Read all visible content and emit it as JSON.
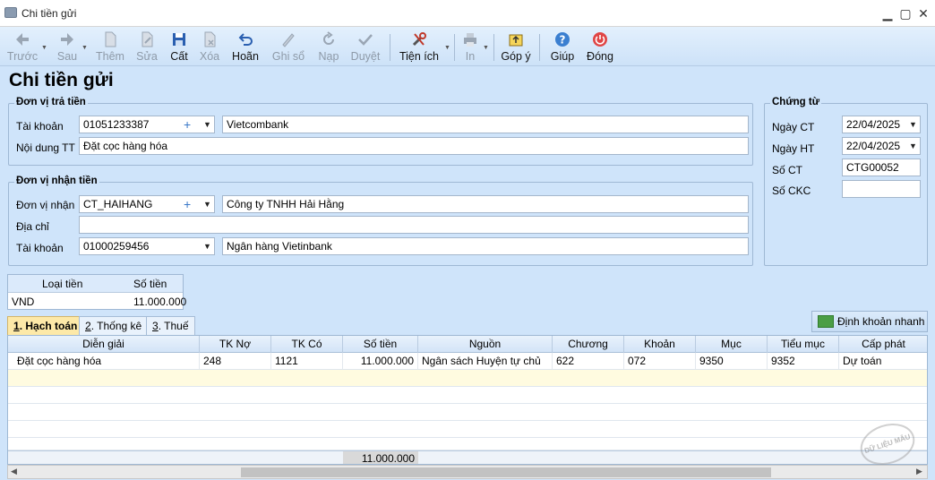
{
  "window": {
    "title": "Chi tiền gửi",
    "minimize": "▁",
    "maximize": "▢",
    "close": "✕"
  },
  "toolbar": {
    "back": "Trước",
    "next": "Sau",
    "add": "Thêm",
    "edit": "Sửa",
    "save": "Cất",
    "delete": "Xóa",
    "undo": "Hoãn",
    "post": "Ghi sổ",
    "reload": "Nạp",
    "approve": "Duyệt",
    "utilities": "Tiện ích",
    "print": "In",
    "feedback": "Góp ý",
    "help": "Giúp",
    "close": "Đóng"
  },
  "page_title": "Chi tiền gửi",
  "payer": {
    "legend": "Đơn vị trả tiền",
    "account_label": "Tài khoản",
    "account_value": "01051233387",
    "bank_name": "Vietcombank",
    "content_label": "Nội dung TT",
    "content_value": "Đặt cọc hàng hóa"
  },
  "payee": {
    "legend": "Đơn vị nhận tiền",
    "unit_label": "Đơn vị nhận",
    "unit_code": "CT_HAIHANG",
    "unit_name": "Công ty TNHH Hải Hằng",
    "address_label": "Địa chỉ",
    "address_value": "",
    "account_label": "Tài khoản",
    "account_value": "01000259456",
    "bank_name": "Ngân hàng Vietinbank"
  },
  "voucher": {
    "legend": "Chứng từ",
    "date_label": "Ngày CT",
    "date_value": "22/04/2025",
    "post_date_label": "Ngày HT",
    "post_date_value": "22/04/2025",
    "number_label": "Số CT",
    "number_value": "CTG00052",
    "ckc_label": "Số CKC",
    "ckc_value": ""
  },
  "currency": {
    "col_type": "Loại tiền",
    "col_amount": "Số tiền",
    "type": "VND",
    "amount": "11.000.000"
  },
  "tabs": [
    {
      "key": "1",
      "label": ". Hạch toán"
    },
    {
      "key": "2",
      "label": ". Thống kê"
    },
    {
      "key": "3",
      "label": ". Thuế"
    }
  ],
  "quick_entry": "Định khoản nhanh",
  "grid": {
    "columns": [
      "Diễn giải",
      "TK Nợ",
      "TK Có",
      "Số tiền",
      "Nguồn",
      "Chương",
      "Khoản",
      "Mục",
      "Tiểu mục",
      "Cấp phát"
    ],
    "rows": [
      [
        "Đặt cọc hàng hóa",
        "248",
        "1121",
        "11.000.000",
        "Ngân sách Huyện tự chủ",
        "622",
        "072",
        "9350",
        "9352",
        "Dự toán"
      ]
    ],
    "total": "11.000.000"
  },
  "watermark": "DỮ LIỆU MẪU"
}
